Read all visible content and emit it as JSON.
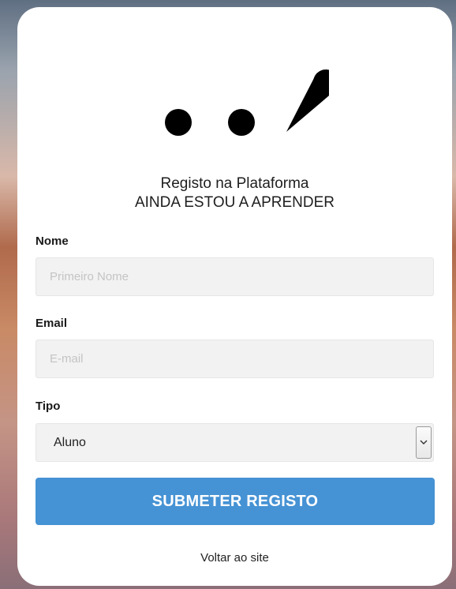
{
  "header": {
    "title_line1": "Registo na Plataforma",
    "title_line2": "AINDA ESTOU A APRENDER",
    "logo_icon": "dots-and-comma-logo"
  },
  "form": {
    "nome": {
      "label": "Nome",
      "placeholder": "Primeiro Nome",
      "value": ""
    },
    "email": {
      "label": "Email",
      "placeholder": "E-mail",
      "value": ""
    },
    "tipo": {
      "label": "Tipo",
      "selected": "Aluno",
      "icon": "chevron-down-icon"
    },
    "submit_label": "SUBMETER REGISTO"
  },
  "footer": {
    "back_link": "Voltar ao site"
  },
  "colors": {
    "accent": "#4592d4",
    "card": "#ffffff",
    "field_bg": "#f2f2f2"
  }
}
